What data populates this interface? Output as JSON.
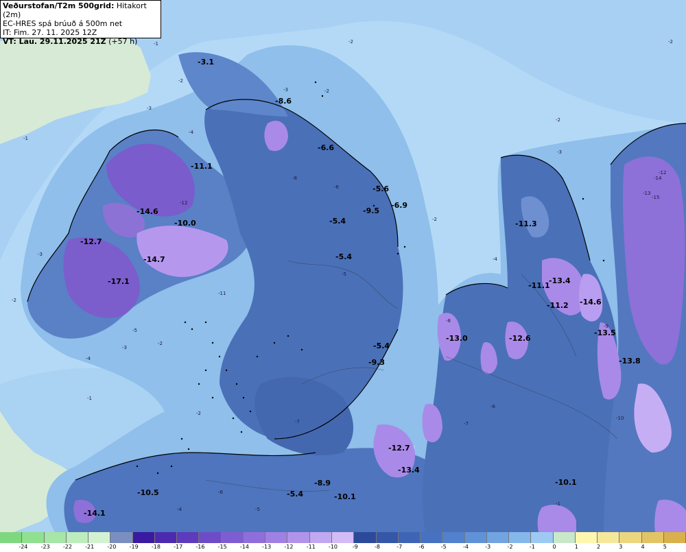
{
  "header": {
    "title": "Veðurstofan/T2m 500grid:",
    "title_suffix": "Hitakort (2m)",
    "line2": "EC-HRES spá brúuð á 500m net",
    "line3": "IT: Fim. 27. 11. 2025 12Z",
    "line4_bold": "VT: Lau. 29.11.2025 21Z",
    "line4_rest": "(+57 h)"
  },
  "legend": {
    "ticks": [
      "-24",
      "-23",
      "-22",
      "-21",
      "-20",
      "-19",
      "-18",
      "-17",
      "-16",
      "-15",
      "-14",
      "-13",
      "-12",
      "-11",
      "-10",
      "-9",
      "-8",
      "-7",
      "-6",
      "-5",
      "-4",
      "-3",
      "-2",
      "-1",
      "0",
      "1",
      "2",
      "3",
      "4",
      "5"
    ],
    "colors": [
      "#8fe08f",
      "#a6e6a6",
      "#bdecbd",
      "#d2f2d2",
      "#7a8fc0",
      "#3a1aa0",
      "#4b2ab0",
      "#5c3bbd",
      "#6d4cc8",
      "#7e5dd2",
      "#8f6edb",
      "#a080e3",
      "#b194ea",
      "#c2a8f0",
      "#d3bcf5",
      "#2c4a9a",
      "#3557a8",
      "#3e64b5",
      "#4772c2",
      "#5281cd",
      "#6092d8",
      "#72a4e2",
      "#86b7eb",
      "#9ccaf3",
      "#c9e8c9",
      "#fff7b0",
      "#f5e89a",
      "#ecd77f",
      "#e3c464",
      "#d9b04c"
    ]
  },
  "map": {
    "temperature_labels": [
      {
        "id": "l1",
        "text": "-17.1"
      },
      {
        "id": "l2",
        "text": "-14.7"
      },
      {
        "id": "l3",
        "text": "-14.6"
      },
      {
        "id": "l4",
        "text": "-12.7"
      },
      {
        "id": "l5",
        "text": "-10.0"
      },
      {
        "id": "l6",
        "text": "-11.1"
      },
      {
        "id": "l7",
        "text": "-8.6"
      },
      {
        "id": "l8",
        "text": "-6.6"
      },
      {
        "id": "l9",
        "text": "-5.6"
      },
      {
        "id": "l10",
        "text": "-9.5"
      },
      {
        "id": "l11",
        "text": "-6.9"
      },
      {
        "id": "l12",
        "text": "-5.4"
      },
      {
        "id": "l13",
        "text": "-5.4"
      },
      {
        "id": "l14",
        "text": "-5.4"
      },
      {
        "id": "l15",
        "text": "-9.3"
      },
      {
        "id": "l16",
        "text": "-13.0"
      },
      {
        "id": "l17",
        "text": "-12.6"
      },
      {
        "id": "l18",
        "text": "-11.3"
      },
      {
        "id": "l19",
        "text": "-13.4"
      },
      {
        "id": "l20",
        "text": "-11.1"
      },
      {
        "id": "l21",
        "text": "-11.2"
      },
      {
        "id": "l22",
        "text": "-14.6"
      },
      {
        "id": "l23",
        "text": "-13.5"
      },
      {
        "id": "l24",
        "text": "-13.8"
      },
      {
        "id": "l25",
        "text": "-12.7"
      },
      {
        "id": "l26",
        "text": "-13.4"
      },
      {
        "id": "l27",
        "text": "-10.1"
      },
      {
        "id": "l28",
        "text": "-10.5"
      },
      {
        "id": "l29",
        "text": "-14.1"
      },
      {
        "id": "l30",
        "text": "-5.4"
      },
      {
        "id": "l31",
        "text": "-8.9"
      },
      {
        "id": "l32",
        "text": "-10.1"
      },
      {
        "id": "l33",
        "text": "-3.1"
      }
    ],
    "contour_labels": [
      {
        "id": "c1",
        "text": "-1"
      },
      {
        "id": "c2",
        "text": "-2"
      },
      {
        "id": "c3",
        "text": "-2"
      },
      {
        "id": "c4",
        "text": "-3"
      },
      {
        "id": "c5",
        "text": "-4"
      },
      {
        "id": "c6",
        "text": "-2"
      },
      {
        "id": "c7",
        "text": "-3"
      },
      {
        "id": "c8",
        "text": "-1"
      },
      {
        "id": "c9",
        "text": "-2"
      },
      {
        "id": "c10",
        "text": "-3"
      },
      {
        "id": "c11",
        "text": "-4"
      },
      {
        "id": "c12",
        "text": "-5"
      },
      {
        "id": "c13",
        "text": "-2"
      },
      {
        "id": "c14",
        "text": "-1"
      },
      {
        "id": "c15",
        "text": "-2"
      },
      {
        "id": "c16",
        "text": "-3"
      },
      {
        "id": "c17",
        "text": "-4"
      },
      {
        "id": "c18",
        "text": "-2"
      },
      {
        "id": "c19",
        "text": "-2"
      },
      {
        "id": "c20",
        "text": "-3"
      },
      {
        "id": "c21",
        "text": "-2"
      },
      {
        "id": "c22",
        "text": "-1"
      },
      {
        "id": "c23",
        "text": "-8"
      },
      {
        "id": "c24",
        "text": "-6"
      },
      {
        "id": "c25",
        "text": "-7"
      },
      {
        "id": "c26",
        "text": "-12"
      },
      {
        "id": "c27",
        "text": "-14"
      },
      {
        "id": "c28",
        "text": "-15"
      },
      {
        "id": "c29",
        "text": "-13"
      },
      {
        "id": "c30",
        "text": "-10"
      },
      {
        "id": "c31",
        "text": "-9"
      },
      {
        "id": "c32",
        "text": "-6"
      },
      {
        "id": "c33",
        "text": "-5"
      },
      {
        "id": "c34",
        "text": "-8"
      },
      {
        "id": "c35",
        "text": "-7"
      },
      {
        "id": "c36",
        "text": "-12"
      },
      {
        "id": "c37",
        "text": "-11"
      },
      {
        "id": "c38",
        "text": "-5"
      },
      {
        "id": "c39",
        "text": "-4"
      },
      {
        "id": "c40",
        "text": "-6"
      }
    ]
  }
}
